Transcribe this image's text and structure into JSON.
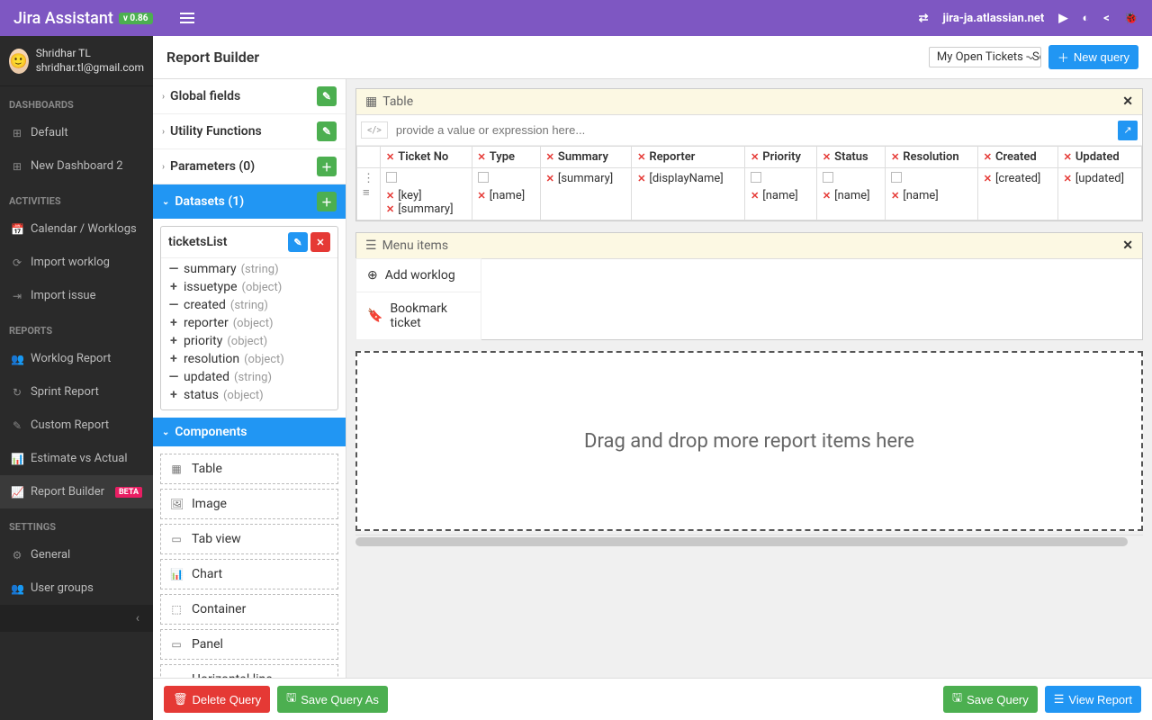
{
  "app": {
    "name": "Jira Assistant",
    "version": "v 0.86"
  },
  "topbar": {
    "domain": "jira-ja.atlassian.net"
  },
  "user": {
    "name": "Shridhar TL",
    "email": "shridhar.tl@gmail.com"
  },
  "sidebar": {
    "sections": [
      {
        "title": "DASHBOARDS",
        "items": [
          {
            "icon": "⊞",
            "label": "Default"
          },
          {
            "icon": "⊞",
            "label": "New Dashboard 2"
          }
        ]
      },
      {
        "title": "ACTIVITIES",
        "items": [
          {
            "icon": "📅",
            "label": "Calendar / Worklogs"
          },
          {
            "icon": "⟳",
            "label": "Import worklog"
          },
          {
            "icon": "⇥",
            "label": "Import issue"
          }
        ]
      },
      {
        "title": "REPORTS",
        "items": [
          {
            "icon": "👥",
            "label": "Worklog Report"
          },
          {
            "icon": "↻",
            "label": "Sprint Report"
          },
          {
            "icon": "✎",
            "label": "Custom Report"
          },
          {
            "icon": "📊",
            "label": "Estimate vs Actual"
          },
          {
            "icon": "📈",
            "label": "Report Builder",
            "badge": "BETA",
            "active": true
          }
        ]
      },
      {
        "title": "SETTINGS",
        "items": [
          {
            "icon": "⚙",
            "label": "General"
          },
          {
            "icon": "👥",
            "label": "User groups"
          }
        ]
      }
    ]
  },
  "page": {
    "title": "Report Builder",
    "querySelector": "My Open Tickets - Sor",
    "newQuery": "New query"
  },
  "leftPanel": {
    "groups": [
      {
        "label": "Global fields",
        "action": "edit"
      },
      {
        "label": "Utility Functions",
        "action": "edit"
      },
      {
        "label": "Parameters (0)",
        "action": "add"
      }
    ],
    "datasetsHeader": "Datasets (1)",
    "dataset": {
      "name": "ticketsList",
      "fields": [
        {
          "pm": "—",
          "name": "summary",
          "type": "(string)"
        },
        {
          "pm": "+",
          "name": "issuetype",
          "type": "(object)"
        },
        {
          "pm": "—",
          "name": "created",
          "type": "(string)"
        },
        {
          "pm": "+",
          "name": "reporter",
          "type": "(object)"
        },
        {
          "pm": "+",
          "name": "priority",
          "type": "(object)"
        },
        {
          "pm": "+",
          "name": "resolution",
          "type": "(object)"
        },
        {
          "pm": "—",
          "name": "updated",
          "type": "(string)"
        },
        {
          "pm": "+",
          "name": "status",
          "type": "(object)"
        }
      ]
    },
    "componentsHeader": "Components",
    "components": [
      {
        "icon": "▦",
        "label": "Table"
      },
      {
        "icon": "🖼",
        "label": "Image"
      },
      {
        "icon": "▭",
        "label": "Tab view"
      },
      {
        "icon": "📊",
        "label": "Chart"
      },
      {
        "icon": "⬚",
        "label": "Container"
      },
      {
        "icon": "▭",
        "label": "Panel"
      },
      {
        "icon": "—",
        "label": "Horizontal line"
      }
    ]
  },
  "canvas": {
    "tableTitle": "Table",
    "exprPlaceholder": "provide a value or expression here...",
    "columns": [
      "Ticket No",
      "Type",
      "Summary",
      "Reporter",
      "Priority",
      "Status",
      "Resolution",
      "Created",
      "Updated"
    ],
    "row": {
      "col0a": "[key]",
      "col0b": "[summary]",
      "col1": "[name]",
      "col2": "[summary]",
      "col3": "[displayName]",
      "col4": "[name]",
      "col5": "[name]",
      "col6": "[name]",
      "col7": "[created]",
      "col8": "[updated]"
    },
    "menuTitle": "Menu items",
    "menuItems": [
      {
        "icon": "⊕",
        "label": "Add worklog"
      },
      {
        "icon": "🔖",
        "label": "Bookmark ticket"
      }
    ],
    "dropText": "Drag and drop more report items here"
  },
  "footer": {
    "delete": "Delete Query",
    "saveAs": "Save Query As",
    "save": "Save Query",
    "view": "View Report"
  }
}
